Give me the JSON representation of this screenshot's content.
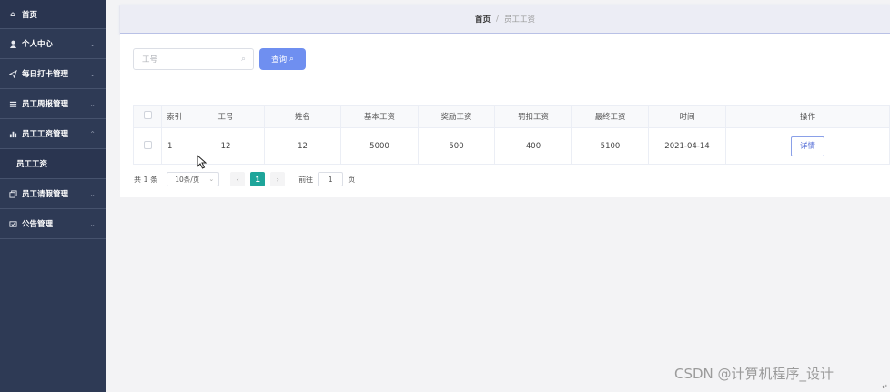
{
  "sidebar": {
    "items": [
      {
        "icon": "home-icon",
        "label": "首页"
      },
      {
        "icon": "user-icon",
        "label": "个人中心"
      },
      {
        "icon": "send-icon",
        "label": "每日打卡管理"
      },
      {
        "icon": "list-icon",
        "label": "员工周报管理"
      },
      {
        "icon": "chart-icon",
        "label": "员工工资管理"
      },
      {
        "sub": true,
        "label": "员工工资"
      },
      {
        "icon": "copy-icon",
        "label": "员工请假管理"
      },
      {
        "icon": "notice-icon",
        "label": "公告管理"
      }
    ]
  },
  "breadcrumb": {
    "home": "首页",
    "separator": "/",
    "current": "员工工资"
  },
  "search": {
    "placeholder": "工号",
    "button_label": "查询"
  },
  "table": {
    "headers": [
      "索引",
      "工号",
      "姓名",
      "基本工资",
      "奖励工资",
      "罚扣工资",
      "最终工资",
      "时间",
      "操作"
    ],
    "rows": [
      {
        "index": "1",
        "emp_no": "12",
        "name": "12",
        "base": "5000",
        "bonus": "500",
        "penalty": "400",
        "final": "5100",
        "date": "2021-04-14",
        "action": "详情"
      }
    ]
  },
  "pager": {
    "total": "共 1 条",
    "page_size": "10条/页",
    "current_page": "1",
    "goto_label": "前往",
    "goto_value": "1",
    "goto_unit": "页"
  },
  "watermark": "CSDN @计算机程序_设计",
  "corner_mark": "↵",
  "colors": {
    "sidebar": "#2e3a55",
    "primary": "#6f8ff0",
    "page_active": "#1ea59a"
  }
}
